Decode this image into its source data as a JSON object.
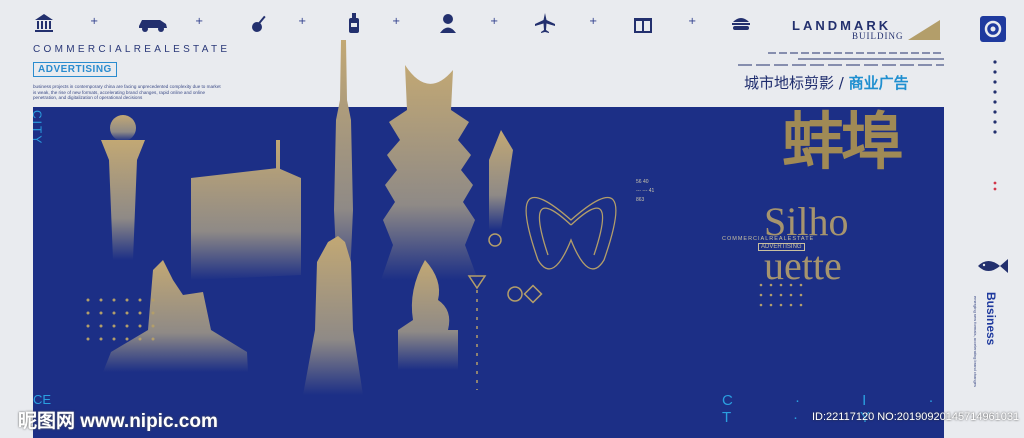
{
  "header": {
    "icons": [
      "bank-icon",
      "car-icon",
      "guitar-icon",
      "bottle-icon",
      "person-portrait-icon",
      "airplane-icon",
      "gift-icon",
      "burger-icon"
    ],
    "commercial_label": "COMMERCIALREALESTATE",
    "advertising_badge": "ADVERTISING",
    "small_text": "business projects in contemporary china are facing unprecedented complexity due to market is weak, the rise of new formats, accelerating brand changes, rapid online and online penetration, and digitalization of operational decisions",
    "landmark_label": "LANDMARK",
    "building_label": "BUILDING",
    "cn_title_left": "城市地标剪影 / ",
    "cn_title_highlight": "商业广告"
  },
  "poster": {
    "city_vertical": "CITY",
    "big_cn_chars": "蚌埠",
    "silhouette_line1": "Silho",
    "silhouette_line2": "uette",
    "commercial_small": "COMMERCIALREALESTATE",
    "advertising_small": "ADVERTISING",
    "numbers": [
      "56 40",
      "--- --- 41",
      "863"
    ],
    "city_bottom": "C · I · T · Y",
    "ce_fragment": "CE"
  },
  "sidebar": {
    "business_label": "Business",
    "business_text": "emerging new formats, accelerating brand changes"
  },
  "watermark": {
    "site": "昵图网 www.nipic.com",
    "id_text": "ID:22117120 NO:20190920145714961031"
  },
  "colors": {
    "navy": "#1c2f86",
    "gold": "#b39e6a",
    "accent_blue": "#1f8fd0",
    "background": "#e9ebef"
  }
}
